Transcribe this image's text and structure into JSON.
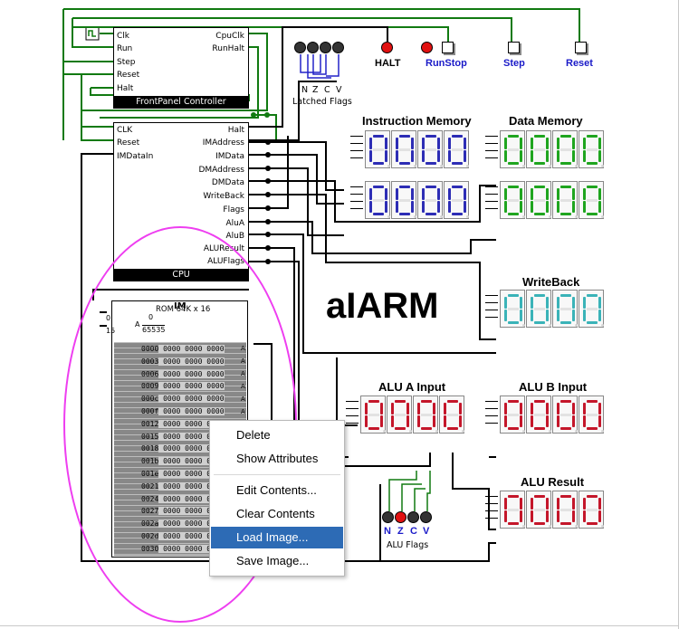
{
  "front_panel": {
    "title": "FrontPanel Controller",
    "left_pins": [
      "Clk",
      "Run",
      "Step",
      "Reset",
      "Halt"
    ],
    "right_pins": [
      "CpuClk",
      "RunHalt"
    ]
  },
  "cpu": {
    "title": "CPU",
    "left_pins": [
      "CLK",
      "Reset",
      "IMDataIn"
    ],
    "right_pins": [
      "Halt",
      "IMAddress",
      "IMData",
      "DMAddress",
      "DMData",
      "WriteBack",
      "Flags",
      "AluA",
      "AluB",
      "ALUResult",
      "ALUFlags"
    ]
  },
  "im": {
    "title": "IM",
    "rom_label": "ROM 64K x 16",
    "in_top": "0",
    "in_bottom": "15",
    "addr_a": "A",
    "addr_zero": "0",
    "addr_max": "65535",
    "rows": [
      {
        "addr": "0000",
        "cells": "0000 0000 0000"
      },
      {
        "addr": "0003",
        "cells": "0000 0000 0000"
      },
      {
        "addr": "0006",
        "cells": "0000 0000 0000"
      },
      {
        "addr": "0009",
        "cells": "0000 0000 0000"
      },
      {
        "addr": "000c",
        "cells": "0000 0000 0000"
      },
      {
        "addr": "000f",
        "cells": "0000 0000 0000"
      },
      {
        "addr": "0012",
        "cells": "0000 0000 0000"
      },
      {
        "addr": "0015",
        "cells": "0000 0000 0000"
      },
      {
        "addr": "0018",
        "cells": "0000 0000 0000"
      },
      {
        "addr": "001b",
        "cells": "0000 0000 0000"
      },
      {
        "addr": "001e",
        "cells": "0000 0000 0000"
      },
      {
        "addr": "0021",
        "cells": "0000 0000 0000"
      },
      {
        "addr": "0024",
        "cells": "0000 0000 0000"
      },
      {
        "addr": "0027",
        "cells": "0000 0000 0000"
      },
      {
        "addr": "002a",
        "cells": "0000 0000 0000"
      },
      {
        "addr": "002d",
        "cells": "0000 0000 0000"
      },
      {
        "addr": "0030",
        "cells": "0000 0000 0000"
      }
    ]
  },
  "title": "aIARM",
  "indicators": {
    "halt": "HALT",
    "runstop": "RunStop",
    "step": "Step",
    "reset": "Reset",
    "latched_flags": "Latched Flags",
    "latched_letters": [
      "N",
      "Z",
      "C",
      "V"
    ],
    "alu_flags": "ALU Flags",
    "alu_letters": [
      "N",
      "Z",
      "C",
      "V"
    ]
  },
  "displays": {
    "instruction_memory": "Instruction Memory",
    "data_memory": "Data Memory",
    "writeback": "WriteBack",
    "alu_a": "ALU A Input",
    "alu_b": "ALU B Input",
    "alu_result": "ALU Result",
    "digit": "0"
  },
  "context_menu": {
    "items": [
      "Delete",
      "Show Attributes",
      "Edit Contents...",
      "Clear Contents",
      "Load Image...",
      "Save Image..."
    ],
    "selected": "Load Image..."
  },
  "colors": {
    "wire_green": "#117a11",
    "wire_black": "#000000",
    "wire_blue": "#2323c8",
    "seg_blue": "#2d2db5",
    "seg_green": "#1fa51f",
    "seg_cyan": "#3ab3b8",
    "seg_red": "#c4162a",
    "led_red": "#e11111",
    "led_dark": "#333333",
    "menu_highlight": "#2d6bb5",
    "annotation_magenta": "#ee3ef0"
  }
}
